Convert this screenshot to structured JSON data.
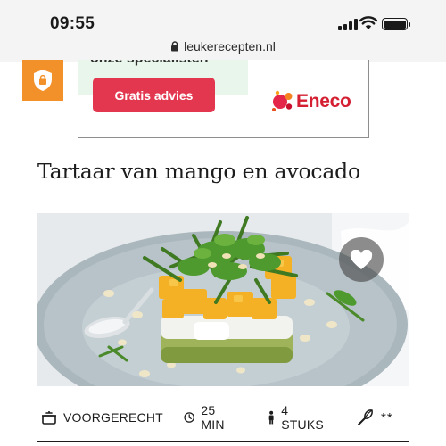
{
  "status_bar": {
    "time": "09:55",
    "url": "leukerecepten.nl"
  },
  "ad": {
    "cut_off_text": "onze specialisten",
    "button_label": "Gratis advies",
    "brand_name": "Eneco",
    "colors": {
      "button": "#e3374f",
      "brand": "#d42032",
      "panel": "#e9f6ec",
      "shield_tab": "#f29129"
    }
  },
  "recipe": {
    "title": "Tartaar van mango en avocado",
    "meta": {
      "course": "VOORGERECHT",
      "time": "25 MIN",
      "servings": "4 STUKS",
      "difficulty": "**"
    }
  },
  "icons": [
    "lock-icon",
    "shield-icon",
    "heart-icon",
    "course-icon",
    "clock-icon",
    "person-icon",
    "whisk-icon"
  ]
}
